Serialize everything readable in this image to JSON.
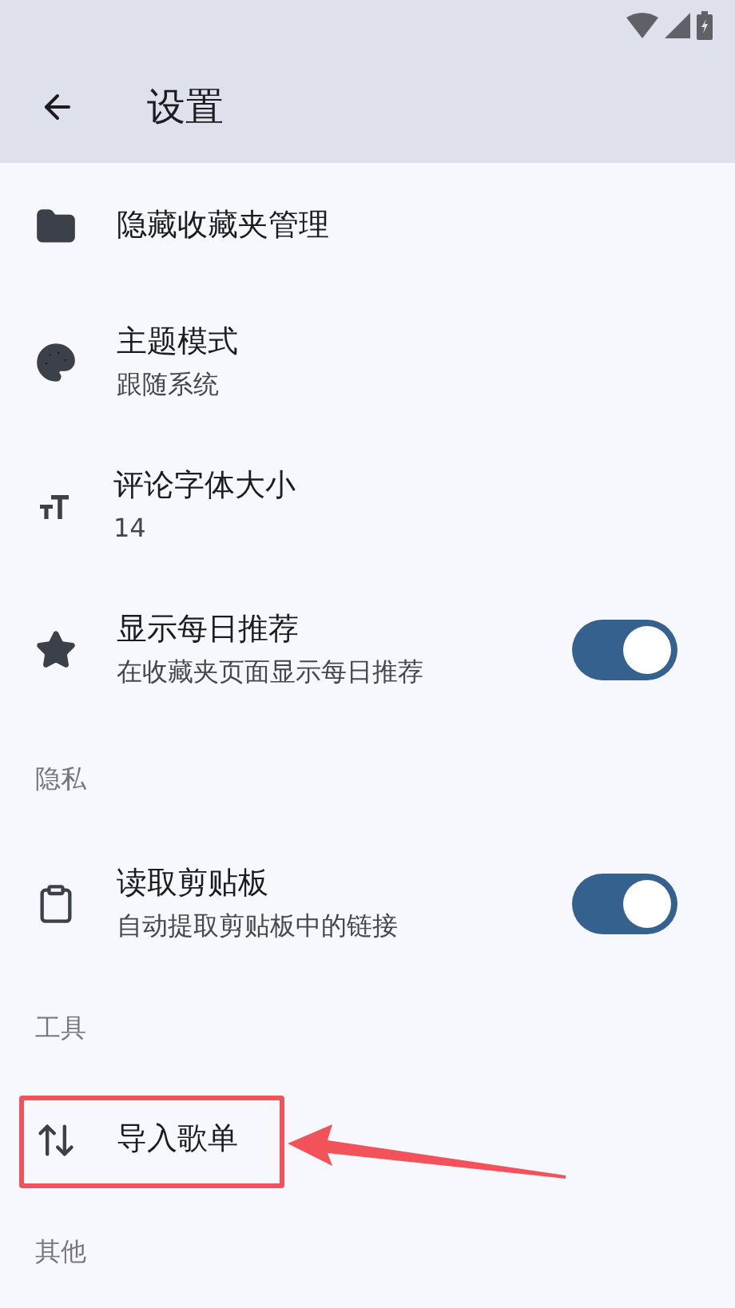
{
  "app_bar": {
    "title": "设置"
  },
  "sections": [
    {
      "items": [
        {
          "title": "隐藏收藏夹管理"
        },
        {
          "title": "主题模式",
          "subtitle": "跟随系统"
        },
        {
          "title": "评论字体大小",
          "subtitle": "14"
        },
        {
          "title": "显示每日推荐",
          "subtitle": "在收藏夹页面显示每日推荐",
          "toggle": {
            "on": true
          }
        }
      ]
    },
    {
      "title": "隐私",
      "items": [
        {
          "title": "读取剪贴板",
          "subtitle": "自动提取剪贴板中的链接",
          "toggle": {
            "on": true
          }
        }
      ]
    },
    {
      "title": "工具",
      "items": [
        {
          "title": "导入歌单",
          "annotated": true
        }
      ]
    },
    {
      "title": "其他"
    }
  ]
}
